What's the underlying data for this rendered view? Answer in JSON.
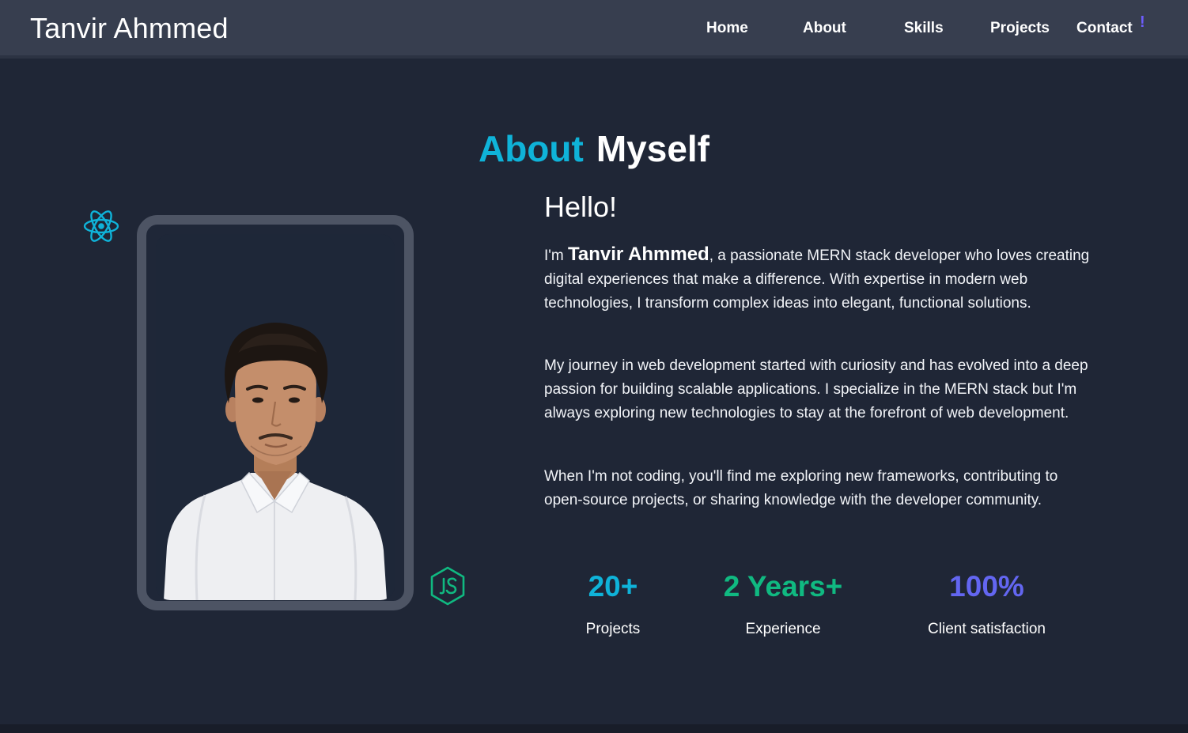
{
  "brand": {
    "name": "Tanvir Ahmmed"
  },
  "nav": {
    "items": [
      {
        "label": "Home"
      },
      {
        "label": "About"
      },
      {
        "label": "Skills"
      },
      {
        "label": "Projects"
      },
      {
        "label": "Contact"
      }
    ],
    "badge": "!"
  },
  "section": {
    "title_accent": "About",
    "title_rest": "Myself"
  },
  "about": {
    "greeting": "Hello!",
    "intro_prefix": "I'm ",
    "intro_name": "Tanvir Ahmmed",
    "intro_suffix": ", a passionate MERN stack developer who loves creating digital experiences that make a difference. With expertise in modern web technologies, I transform complex ideas into elegant, functional solutions.",
    "paragraph_2": "My journey in web development started with curiosity and has evolved into a deep passion for building scalable applications. I specialize in the MERN stack but I'm always exploring new technologies to stay at the forefront of web development.",
    "paragraph_3": "When I'm not coding, you'll find me exploring new frameworks, contributing to open-source projects, or sharing knowledge with the developer community."
  },
  "stats": [
    {
      "value": "20+",
      "label": "Projects",
      "color": "#0fb3d9"
    },
    {
      "value": "2 Years+",
      "label": "Experience",
      "color": "#10b981"
    },
    {
      "value": "100%",
      "label": "Client satisfaction",
      "color": "#6366f1"
    }
  ],
  "icons": {
    "floating_left": "react-icon",
    "floating_right": "nodejs-icon"
  },
  "colors": {
    "accent": "#0fb3d9",
    "background": "#1f2636",
    "navbar": "#373e4f",
    "frame": "#4d5464"
  }
}
